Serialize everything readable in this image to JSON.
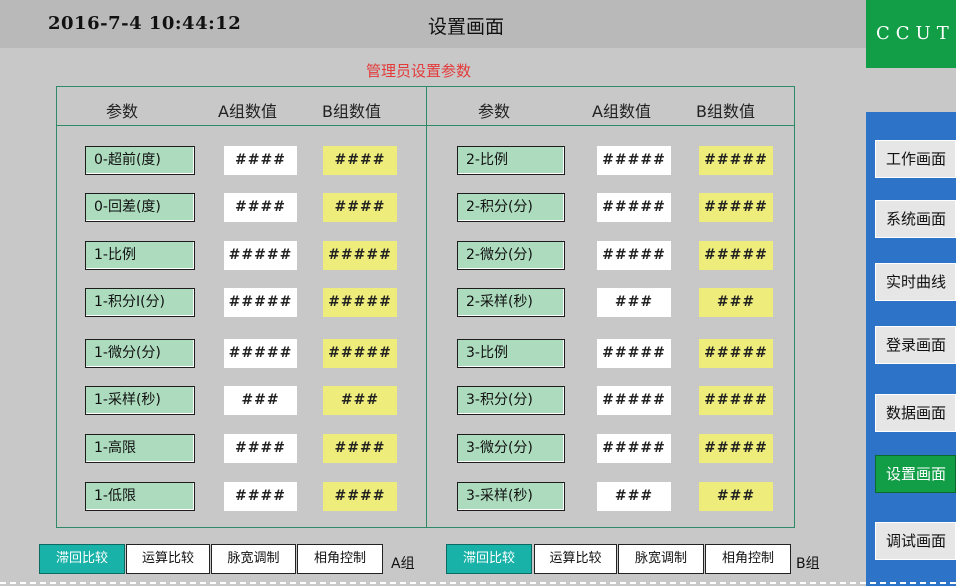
{
  "header": {
    "datetime": "2016-7-4 10:44:12",
    "title": "设置画面"
  },
  "subtitle": "管理员设置参数",
  "table": {
    "headers": {
      "param": "参数",
      "a": "A组数值",
      "b": "B组数值"
    },
    "left_rows": [
      {
        "name": "0-超前(度)",
        "a": "####",
        "b": "####"
      },
      {
        "name": "0-回差(度)",
        "a": "####",
        "b": "####"
      },
      {
        "name": "1-比例",
        "a": "#####",
        "b": "#####"
      },
      {
        "name": "1-积分I(分)",
        "a": "#####",
        "b": "#####"
      },
      {
        "name": "1-微分(分)",
        "a": "#####",
        "b": "#####"
      },
      {
        "name": "1-采样(秒)",
        "a": "###",
        "b": "###"
      },
      {
        "name": "1-高限",
        "a": "####",
        "b": "####"
      },
      {
        "name": "1-低限",
        "a": "####",
        "b": "####"
      }
    ],
    "right_rows": [
      {
        "name": "2-比例",
        "a": "#####",
        "b": "#####"
      },
      {
        "name": "2-积分(分)",
        "a": "#####",
        "b": "#####"
      },
      {
        "name": "2-微分(分)",
        "a": "#####",
        "b": "#####"
      },
      {
        "name": "2-采样(秒)",
        "a": "###",
        "b": "###"
      },
      {
        "name": "3-比例",
        "a": "#####",
        "b": "#####"
      },
      {
        "name": "3-积分(分)",
        "a": "#####",
        "b": "#####"
      },
      {
        "name": "3-微分(分)",
        "a": "#####",
        "b": "#####"
      },
      {
        "name": "3-采样(秒)",
        "a": "###",
        "b": "###"
      }
    ]
  },
  "mode_a": {
    "buttons": [
      "滞回比较",
      "运算比较",
      "脉宽调制",
      "相角控制"
    ],
    "label": "A组"
  },
  "mode_b": {
    "buttons": [
      "滞回比较",
      "运算比较",
      "脉宽调制",
      "相角控制"
    ],
    "label": "B组"
  },
  "sidebar": {
    "brand": "CCUT",
    "nav": [
      "工作画面",
      "系统画面",
      "实时曲线",
      "登录画面",
      "数据画面",
      "设置画面",
      "调试画面"
    ],
    "active_index": 5
  },
  "colors": {
    "accent_green": "#129e47",
    "teal_active": "#19b2a8",
    "nav_blue": "#2d73c8",
    "b_value_yellow": "#eeec7b",
    "param_green": "#acdbbd",
    "subtitle_red": "#e43a3a"
  }
}
